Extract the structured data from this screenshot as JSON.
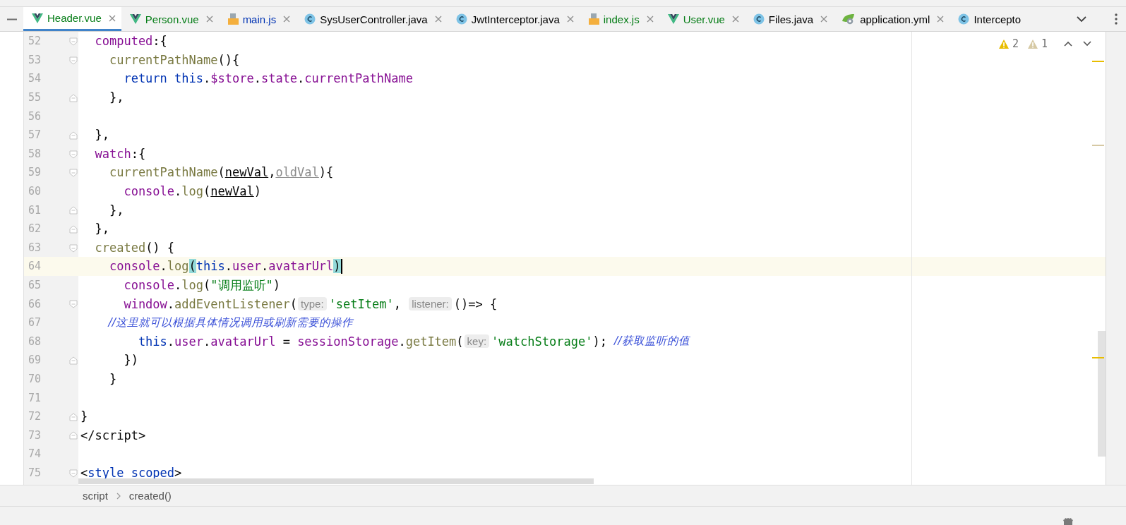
{
  "tabs": [
    {
      "label": "Header.vue",
      "kind": "vue",
      "color": "#067d17",
      "selected": true
    },
    {
      "label": "Person.vue",
      "kind": "vue",
      "color": "#067d17",
      "selected": false
    },
    {
      "label": "main.js",
      "kind": "js",
      "color": "#0033b3",
      "selected": false
    },
    {
      "label": "SysUserController.java",
      "kind": "java",
      "color": "#000000",
      "selected": false
    },
    {
      "label": "JwtInterceptor.java",
      "kind": "java",
      "color": "#000000",
      "selected": false
    },
    {
      "label": "index.js",
      "kind": "js",
      "color": "#067d17",
      "selected": false
    },
    {
      "label": "User.vue",
      "kind": "vue",
      "color": "#067d17",
      "selected": false
    },
    {
      "label": "Files.java",
      "kind": "java",
      "color": "#000000",
      "selected": false
    },
    {
      "label": "application.yml",
      "kind": "yml",
      "color": "#000000",
      "selected": false
    },
    {
      "label": "Intercepto",
      "kind": "java",
      "color": "#000000",
      "selected": false
    }
  ],
  "inspections": [
    {
      "kind": "warning",
      "count": "2"
    },
    {
      "kind": "weak",
      "count": "1"
    }
  ],
  "lines": [
    {
      "number": "52",
      "fold_start": true,
      "fold_end": false,
      "current": false,
      "tokens": [
        {
          "kind": "prop",
          "text": "  computed"
        },
        {
          "kind": "plain",
          "text": ":{"
        }
      ]
    },
    {
      "number": "53",
      "fold_start": true,
      "fold_end": false,
      "current": false,
      "tokens": [
        {
          "kind": "fn",
          "text": "    currentPathName"
        },
        {
          "kind": "plain",
          "text": "(){"
        }
      ]
    },
    {
      "number": "54",
      "fold_start": false,
      "fold_end": false,
      "current": false,
      "tokens": [
        {
          "kind": "kw",
          "text": "      return this"
        },
        {
          "kind": "plain",
          "text": "."
        },
        {
          "kind": "prop",
          "text": "$store"
        },
        {
          "kind": "plain",
          "text": "."
        },
        {
          "kind": "prop",
          "text": "state"
        },
        {
          "kind": "plain",
          "text": "."
        },
        {
          "kind": "prop",
          "text": "currentPathName"
        }
      ]
    },
    {
      "number": "55",
      "fold_start": false,
      "fold_end": true,
      "current": false,
      "tokens": [
        {
          "kind": "plain",
          "text": "    },"
        }
      ]
    },
    {
      "number": "56",
      "fold_start": false,
      "fold_end": false,
      "current": false
    },
    {
      "number": "57",
      "fold_start": false,
      "fold_end": true,
      "current": false,
      "tokens": [
        {
          "kind": "plain",
          "text": "  },"
        }
      ]
    },
    {
      "number": "58",
      "fold_start": true,
      "fold_end": false,
      "current": false,
      "tokens": [
        {
          "kind": "prop",
          "text": "  watch"
        },
        {
          "kind": "plain",
          "text": ":{"
        }
      ]
    },
    {
      "number": "59",
      "fold_start": true,
      "fold_end": false,
      "current": false,
      "tokens": [
        {
          "kind": "fn",
          "text": "    currentPathName"
        },
        {
          "kind": "plain",
          "text": "("
        },
        {
          "kind": "param",
          "text": "newVal"
        },
        {
          "kind": "plain",
          "text": ","
        },
        {
          "kind": "unused",
          "text": "oldVal"
        },
        {
          "kind": "plain",
          "text": "){"
        }
      ]
    },
    {
      "number": "60",
      "fold_start": false,
      "fold_end": false,
      "current": false,
      "tokens": [
        {
          "kind": "prop",
          "text": "      console"
        },
        {
          "kind": "plain",
          "text": "."
        },
        {
          "kind": "fn",
          "text": "log"
        },
        {
          "kind": "plain",
          "text": "("
        },
        {
          "kind": "param",
          "text": "newVal"
        },
        {
          "kind": "plain",
          "text": ")"
        }
      ]
    },
    {
      "number": "61",
      "fold_start": false,
      "fold_end": true,
      "current": false,
      "tokens": [
        {
          "kind": "plain",
          "text": "    },"
        }
      ]
    },
    {
      "number": "62",
      "fold_start": false,
      "fold_end": true,
      "current": false,
      "tokens": [
        {
          "kind": "plain",
          "text": "  },"
        }
      ]
    },
    {
      "number": "63",
      "fold_start": true,
      "fold_end": false,
      "current": false,
      "tokens": [
        {
          "kind": "fn",
          "text": "  created"
        },
        {
          "kind": "plain",
          "text": "() {"
        }
      ]
    },
    {
      "number": "64",
      "fold_start": false,
      "fold_end": false,
      "current": true,
      "tokens": [
        {
          "kind": "prop",
          "text": "    console"
        },
        {
          "kind": "plain",
          "text": "."
        },
        {
          "kind": "fn",
          "text": "log"
        },
        {
          "kind": "match",
          "text": "("
        },
        {
          "kind": "kw",
          "text": "this"
        },
        {
          "kind": "plain",
          "text": "."
        },
        {
          "kind": "prop",
          "text": "user"
        },
        {
          "kind": "plain",
          "text": "."
        },
        {
          "kind": "prop",
          "text": "avatarUrl"
        },
        {
          "kind": "match",
          "text": ")"
        },
        {
          "kind": "caret"
        }
      ]
    },
    {
      "number": "65",
      "fold_start": false,
      "fold_end": false,
      "current": false,
      "tokens": [
        {
          "kind": "prop",
          "text": "      console"
        },
        {
          "kind": "plain",
          "text": "."
        },
        {
          "kind": "fn",
          "text": "log"
        },
        {
          "kind": "plain",
          "text": "("
        },
        {
          "kind": "string",
          "text": "\"调用监听\""
        },
        {
          "kind": "plain",
          "text": ")"
        }
      ]
    },
    {
      "number": "66",
      "fold_start": true,
      "fold_end": false,
      "current": false,
      "tokens": [
        {
          "kind": "prop",
          "text": "      window"
        },
        {
          "kind": "plain",
          "text": "."
        },
        {
          "kind": "fn",
          "text": "addEventListener"
        },
        {
          "kind": "plain",
          "text": "("
        },
        {
          "kind": "hint",
          "text": "type:"
        },
        {
          "kind": "string",
          "text": "'setItem'"
        },
        {
          "kind": "plain",
          "text": ", "
        },
        {
          "kind": "hint",
          "text": "listener:"
        },
        {
          "kind": "plain",
          "text": "()=> {"
        }
      ]
    },
    {
      "number": "67",
      "fold_start": false,
      "fold_end": false,
      "current": false,
      "tokens": [
        {
          "kind": "comment",
          "text": "        //这里就可以根据具体情况调用或刷新需要的操作"
        }
      ]
    },
    {
      "number": "68",
      "fold_start": false,
      "fold_end": false,
      "current": false,
      "tokens": [
        {
          "kind": "kw",
          "text": "        this"
        },
        {
          "kind": "plain",
          "text": "."
        },
        {
          "kind": "prop",
          "text": "user"
        },
        {
          "kind": "plain",
          "text": "."
        },
        {
          "kind": "prop",
          "text": "avatarUrl"
        },
        {
          "kind": "plain",
          "text": " = "
        },
        {
          "kind": "prop",
          "text": "sessionStorage"
        },
        {
          "kind": "plain",
          "text": "."
        },
        {
          "kind": "fn",
          "text": "getItem"
        },
        {
          "kind": "plain",
          "text": "("
        },
        {
          "kind": "hint",
          "text": "key:"
        },
        {
          "kind": "string",
          "text": "'watchStorage'"
        },
        {
          "kind": "plain",
          "text": "); "
        },
        {
          "kind": "comment",
          "text": "//获取监听的值"
        }
      ]
    },
    {
      "number": "69",
      "fold_start": false,
      "fold_end": true,
      "current": false,
      "tokens": [
        {
          "kind": "plain",
          "text": "      })"
        }
      ]
    },
    {
      "number": "70",
      "fold_start": false,
      "fold_end": false,
      "current": false,
      "tokens": [
        {
          "kind": "plain",
          "text": "    }"
        }
      ]
    },
    {
      "number": "71",
      "fold_start": false,
      "fold_end": false,
      "current": false
    },
    {
      "number": "72",
      "fold_start": false,
      "fold_end": true,
      "current": false,
      "tokens": [
        {
          "kind": "plain",
          "text": "}"
        }
      ]
    },
    {
      "number": "73",
      "fold_start": false,
      "fold_end": true,
      "current": false,
      "tokens": [
        {
          "kind": "plain",
          "text": "</script>"
        }
      ]
    },
    {
      "number": "74",
      "fold_start": false,
      "fold_end": false,
      "current": false
    },
    {
      "number": "75",
      "fold_start": true,
      "fold_end": false,
      "current": false,
      "tokens": [
        {
          "kind": "plain",
          "text": "<"
        },
        {
          "kind": "tag",
          "text": "style scoped"
        },
        {
          "kind": "plain",
          "text": ">"
        }
      ]
    }
  ],
  "breadcrumbs": [
    "script",
    "created()"
  ]
}
